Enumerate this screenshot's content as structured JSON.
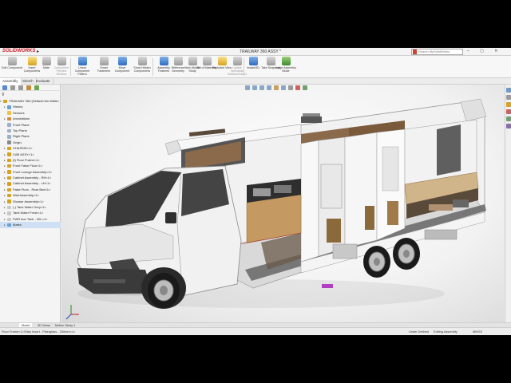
{
  "app": {
    "name": "SOLIDWORKS",
    "document_title": "TRAILWAY 360 ASSY *"
  },
  "search": {
    "placeholder": "Search MySolidWorks"
  },
  "ribbon": {
    "buttons": [
      {
        "label": "Edit Component",
        "icon": "edit-component-icon"
      },
      {
        "label": "Insert Components",
        "icon": "insert-components-icon"
      },
      {
        "label": "Mate",
        "icon": "mate-icon"
      },
      {
        "label": "Component Preview Window",
        "icon": "preview-window-icon"
      },
      {
        "label": "Linear Component Pattern",
        "icon": "linear-pattern-icon"
      },
      {
        "label": "Smart Fasteners",
        "icon": "smart-fasteners-icon"
      },
      {
        "label": "Move Component",
        "icon": "move-component-icon"
      },
      {
        "label": "Show Hidden Components",
        "icon": "show-hidden-icon"
      },
      {
        "label": "Assembly Features",
        "icon": "assembly-features-icon"
      },
      {
        "label": "Reference Geometry",
        "icon": "reference-geometry-icon"
      },
      {
        "label": "New Motion Study",
        "icon": "motion-study-icon"
      },
      {
        "label": "Bill of Materials",
        "icon": "bom-icon"
      },
      {
        "label": "Exploded View",
        "icon": "exploded-view-icon"
      },
      {
        "label": "Instant3D",
        "icon": "instant3d-icon"
      },
      {
        "label": "Update Speedpak Subassemblies",
        "icon": "speedpak-icon"
      },
      {
        "label": "Take Snapshot",
        "icon": "snapshot-icon"
      },
      {
        "label": "Large Assembly Mode",
        "icon": "large-assembly-icon"
      }
    ]
  },
  "command_tabs": [
    "Assembly",
    "Sketch",
    "Evaluate"
  ],
  "tree": {
    "root": "TRAILWAY 360 (Default<No Walls>",
    "items": [
      "History",
      "Annotations",
      "Sensors",
      "Front Plane",
      "Top Plane",
      "Right Plane",
      "Origin",
      "CHASSIS<1>",
      "CAB ASSY<1>",
      "(f) Floor Frame<1>",
      "Front False Floor<1>",
      "Front Lounge Assembly<1>",
      "Cabinet Assembly - RH<1>",
      "Cabinet Assembly - LH<1>",
      "False Floor - Rear Bed<1>",
      "Wall Assembly<1>",
      "Shower Assembly<1>",
      "(-) Tank Water Grey<1>",
      "Tank Water Fresh<1>",
      "FWR Aux Tank - 30L<1>",
      "Mates"
    ]
  },
  "model_tabs": [
    "Model",
    "3D Views",
    "Motion Study 1"
  ],
  "status": {
    "left": "Floor Frame<1>/Step Insert - Fiberglass - 250mm<1>",
    "under_defined": "Under Defined",
    "editing": "Editing Assembly",
    "units": "MMGS"
  },
  "colors": {
    "accent": "#d0202a",
    "selection": "#cfe0f5",
    "viewport_center": "#ffffff",
    "viewport_edge": "#d7d7d7"
  }
}
